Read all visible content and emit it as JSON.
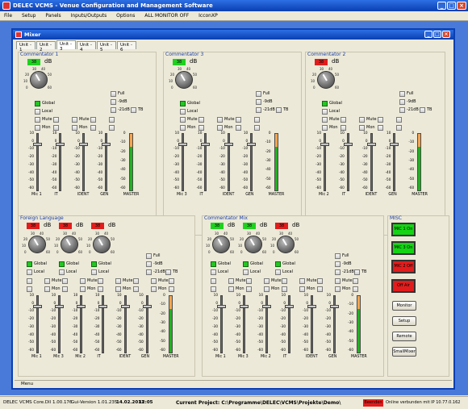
{
  "window": {
    "title": "DELEC VCMS - Venue Configuration and Management Software"
  },
  "menu": [
    "File",
    "Setup",
    "Panels",
    "Inputs/Outputs",
    "Options",
    "ALL MONITOR OFF",
    "IcconXP"
  ],
  "mixer": {
    "title": "Mixer"
  },
  "tabs": [
    "Unit - 1",
    "Unit - 2",
    "Unit - 3",
    "Unit - 4",
    "Unit - 5",
    "Unit - 6"
  ],
  "active_tab": "Unit - 3",
  "db_unit": "dB",
  "labels": {
    "full": "Full",
    "minus9db": "-9dB",
    "minus21db": "-21dB",
    "tb": "TB",
    "global": "Global",
    "local": "Local",
    "mute": "Mute",
    "mon": "Mon"
  },
  "knob_ticks": [
    "20",
    "30",
    "40",
    "10",
    "50",
    "0",
    "60"
  ],
  "scale": [
    "10",
    "0",
    "-10",
    "-20",
    "-30",
    "-40",
    "-50",
    "-60"
  ],
  "scale_master": [
    "0",
    "-10",
    "-20",
    "-30",
    "-40",
    "-50",
    "-60"
  ],
  "panels": {
    "commentator1": {
      "title": "Commentator 1",
      "db": "38",
      "db_color": "green",
      "channels": [
        "Mic 1",
        "IT",
        "IDENT",
        "GEN",
        "MASTER"
      ]
    },
    "commentator3": {
      "title": "Commentator 3",
      "db": "38",
      "db_color": "green",
      "channels": [
        "Mic 3",
        "IT",
        "IDENT",
        "GEN",
        "MASTER"
      ]
    },
    "commentator2": {
      "title": "Commentator 2",
      "db": "38",
      "db_color": "red",
      "channels": [
        "Mic 2",
        "IT",
        "IDENT",
        "GEN",
        "MASTER"
      ]
    },
    "foreign": {
      "title": "Foreign Language",
      "dbs": [
        {
          "v": "38",
          "c": "red"
        },
        {
          "v": "38",
          "c": "red"
        },
        {
          "v": "38",
          "c": "red"
        }
      ],
      "channels": [
        "Mic 1",
        "Mic 3",
        "Mic 2",
        "IT",
        "IDENT",
        "GEN",
        "MASTER"
      ]
    },
    "commix": {
      "title": "Commentator Mix",
      "dbs": [
        {
          "v": "38",
          "c": "green"
        },
        {
          "v": "38",
          "c": "green"
        },
        {
          "v": "38",
          "c": "red"
        }
      ],
      "channels": [
        "Mic 1",
        "Mic 3",
        "Mic 2",
        "IT",
        "IDENT",
        "GEN",
        "MASTER"
      ]
    }
  },
  "misc": {
    "title": "MISC",
    "buttons": [
      {
        "label": "MIC 1 On",
        "color": "#14d414"
      },
      {
        "label": "MIC 3 On",
        "color": "#14d414"
      },
      {
        "label": "MIC 2 Off",
        "color": "#e21c1c"
      },
      {
        "label": "Off Air",
        "color": "#e21c1c"
      }
    ],
    "small_buttons": [
      "Monitor",
      "Setup",
      "Remote",
      "SmallMixer"
    ]
  },
  "bottom_menu": "Menu",
  "status": {
    "core": "DELEC VCMS Core.Dll 1.00.176",
    "gui": "Gui-Version 1.01.235",
    "date": "14.02.2011",
    "time": "12:05",
    "project": "Current Project: C:\\Programme\\DELEC\\VCMS\\Projekte\\Demo\\",
    "badge": "Beenden",
    "online": "Online verbunden mit IP 10.77.0.162"
  }
}
